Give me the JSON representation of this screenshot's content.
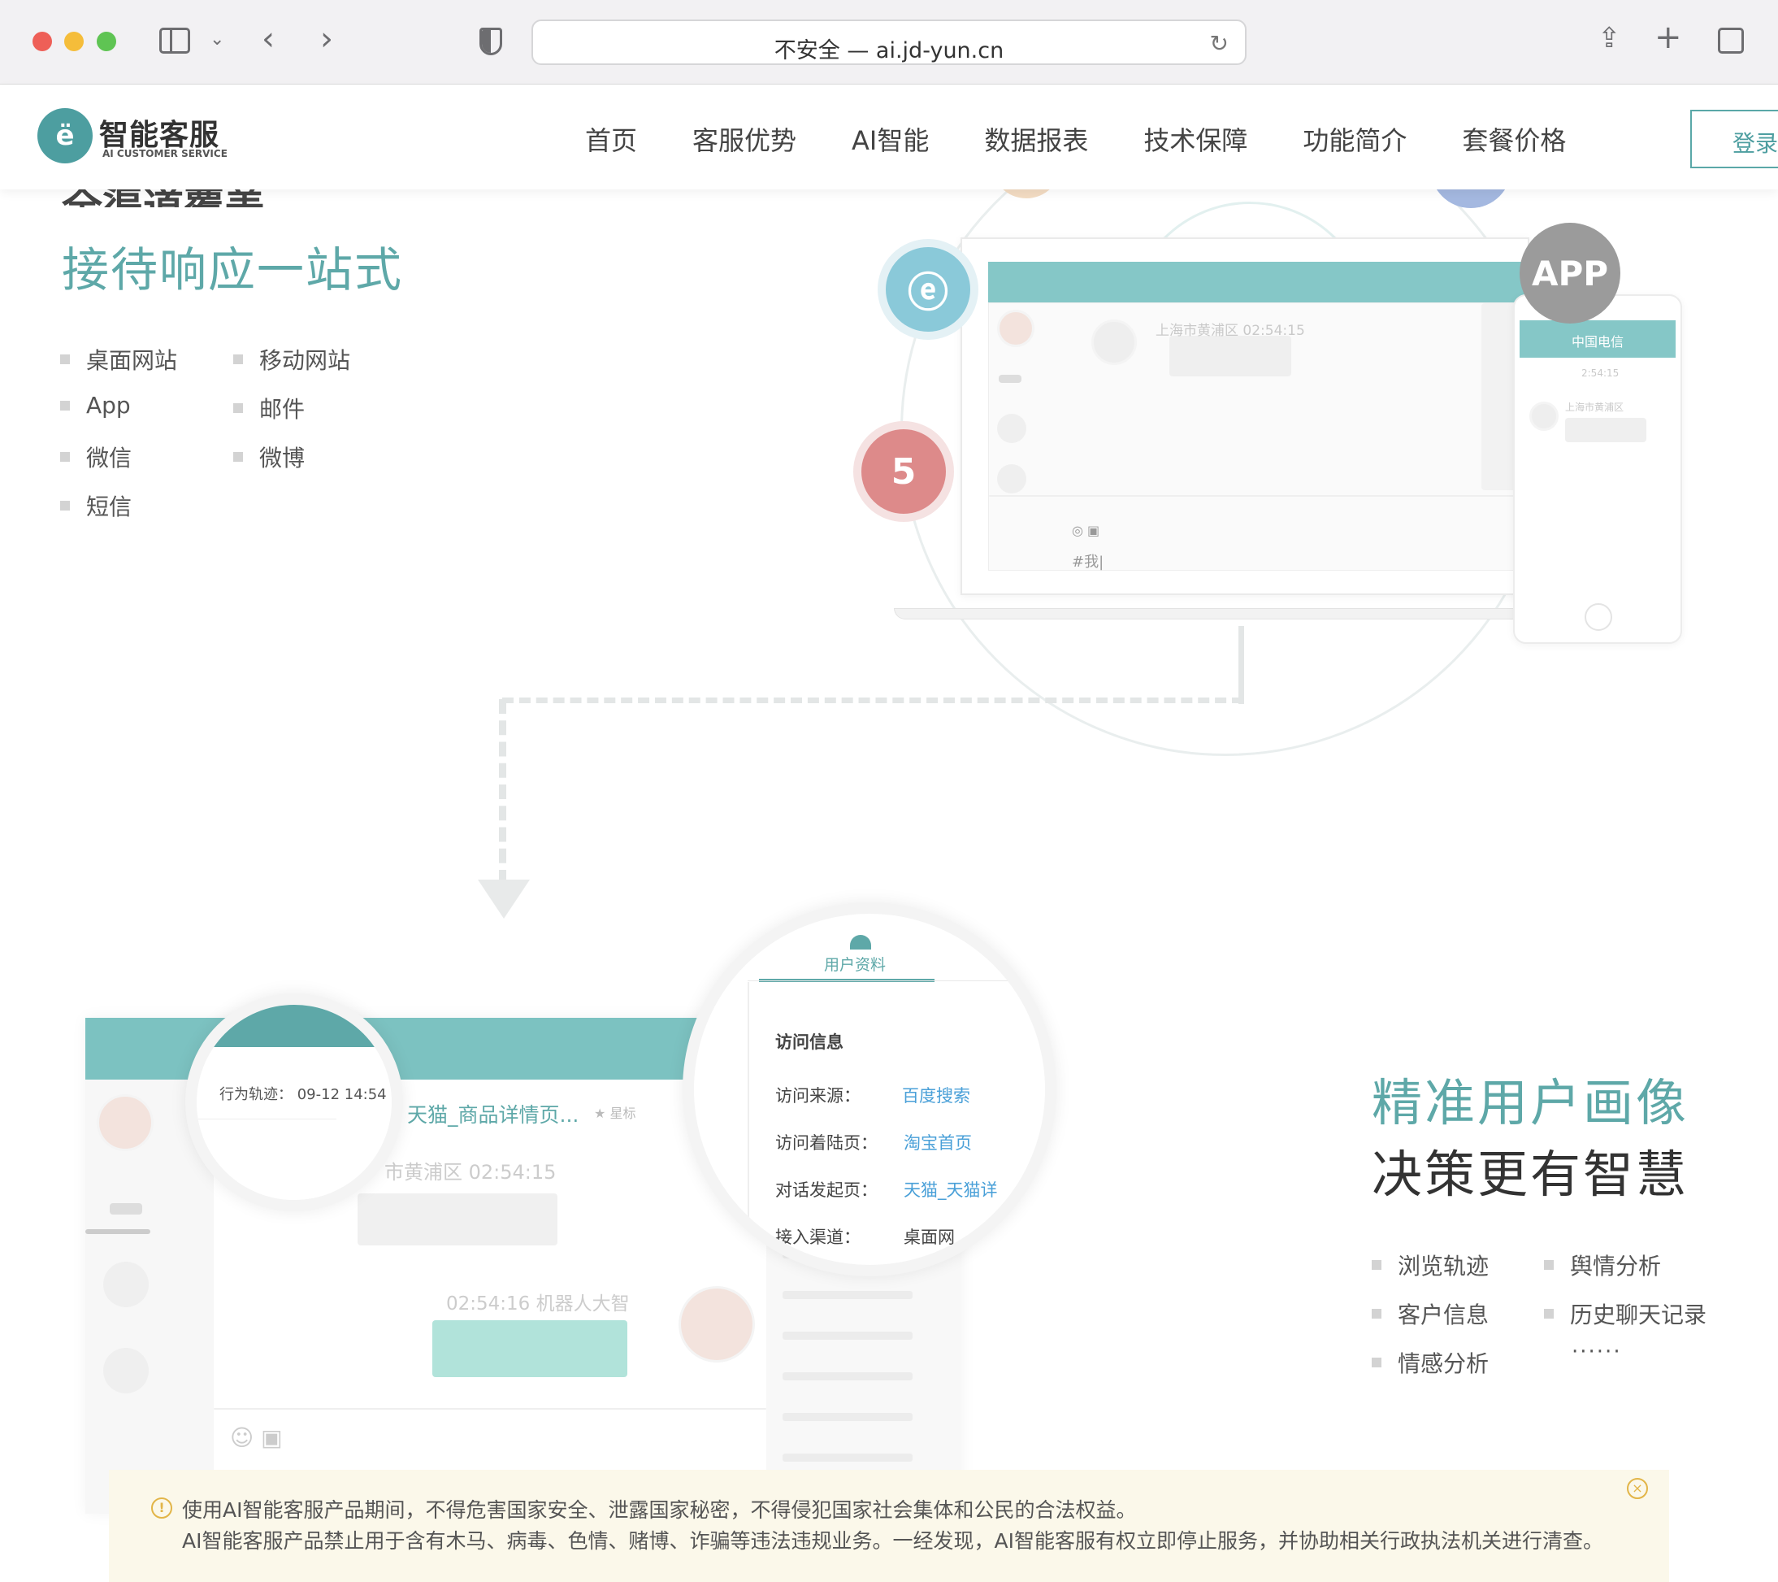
{
  "browser": {
    "url": "不安全 — ai.jd-yun.cn"
  },
  "header": {
    "logo_title": "智能客服",
    "logo_subtitle": "AI CUSTOMER SERVICE",
    "nav": [
      "首页",
      "客服优势",
      "AI智能",
      "数据报表",
      "技术保障",
      "功能简介",
      "套餐价格"
    ],
    "login_label": "登录"
  },
  "section1": {
    "title_partial": "全渠道覆盖",
    "subtitle": "接待响应一站式",
    "features": [
      "桌面网站",
      "移动网站",
      "App",
      "邮件",
      "微信",
      "微博",
      "短信"
    ],
    "app_badge": "APP",
    "chat_location": "上海市黄浦区 02:54:15",
    "input_text": "#我|",
    "phone_title": "中国电信",
    "phone_time": "2:54:15",
    "phone_location": "上海市黄浦区"
  },
  "section2": {
    "title_line1": "精准用户画像",
    "title_line2": "决策更有智慧",
    "features": [
      "浏览轨迹",
      "舆情分析",
      "客户信息",
      "历史聊天记录",
      "情感分析",
      "······"
    ],
    "tab_label": "用户资料",
    "visit_header": "访问信息",
    "visit_rows": [
      {
        "label": "访问来源：",
        "value": "百度搜索"
      },
      {
        "label": "访问着陆页：",
        "value": "淘宝首页"
      },
      {
        "label": "对话发起页：",
        "value": "天猫_天猫详"
      },
      {
        "label": "接入渠道：",
        "value": "桌面网"
      }
    ],
    "behavior_label": "行为轨迹：",
    "behavior_time": "09-12 14:54",
    "page_title": "天猫_商品详情页...",
    "chat_location": "市黄浦区 02:54:15",
    "bot_label": "02:54:16  机器人大智",
    "star_label": "星标"
  },
  "notice": {
    "line1": "使用AI智能客服产品期间，不得危害国家安全、泄露国家秘密，不得侵犯国家社会集体和公民的合法权益。",
    "line2": "AI智能客服产品禁止用于含有木马、病毒、色情、赌博、诈骗等违法违规业务。一经发现，AI智能客服有权立即停止服务，并协助相关行政执法机关进行清查。"
  },
  "colors": {
    "accent": "#5ea8a8",
    "notice_bg": "#fbf8ea",
    "link": "#4aa0d8"
  }
}
